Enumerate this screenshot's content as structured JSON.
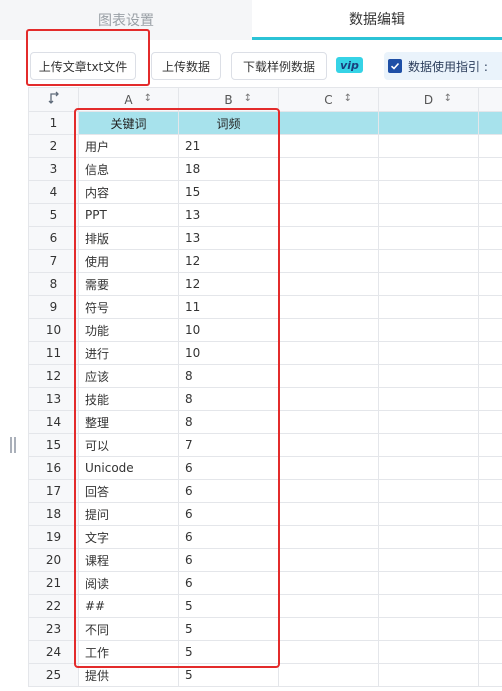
{
  "tabs": {
    "chart_settings": "图表设置",
    "data_edit": "数据编辑"
  },
  "toolbar": {
    "upload_txt": "上传文章txt文件",
    "upload_data": "上传数据",
    "download_sample": "下载样例数据",
    "vip": "vip",
    "guide": "数据使用指引 :"
  },
  "grid": {
    "columns": [
      "A",
      "B",
      "C",
      "D"
    ],
    "header_row": [
      "关键词",
      "词频"
    ],
    "rows": [
      [
        "用户",
        "21"
      ],
      [
        "信息",
        "18"
      ],
      [
        "内容",
        "15"
      ],
      [
        "PPT",
        "13"
      ],
      [
        "排版",
        "13"
      ],
      [
        "使用",
        "12"
      ],
      [
        "需要",
        "12"
      ],
      [
        "符号",
        "11"
      ],
      [
        "功能",
        "10"
      ],
      [
        "进行",
        "10"
      ],
      [
        "应该",
        "8"
      ],
      [
        "技能",
        "8"
      ],
      [
        "整理",
        "8"
      ],
      [
        "可以",
        "7"
      ],
      [
        "Unicode",
        "6"
      ],
      [
        "回答",
        "6"
      ],
      [
        "提问",
        "6"
      ],
      [
        "文字",
        "6"
      ],
      [
        "课程",
        "6"
      ],
      [
        "阅读",
        "6"
      ],
      [
        "##",
        "5"
      ],
      [
        "不同",
        "5"
      ],
      [
        "工作",
        "5"
      ],
      [
        "提供",
        "5"
      ]
    ]
  },
  "colors": {
    "accent": "#2bc3d6",
    "header_fill": "#a7e2ec",
    "highlight": "#e32b2b"
  },
  "icons": {
    "corner": "corner-arrow-icon",
    "sort": "sort-arrow-icon",
    "check": "checkbox-checked-icon"
  }
}
